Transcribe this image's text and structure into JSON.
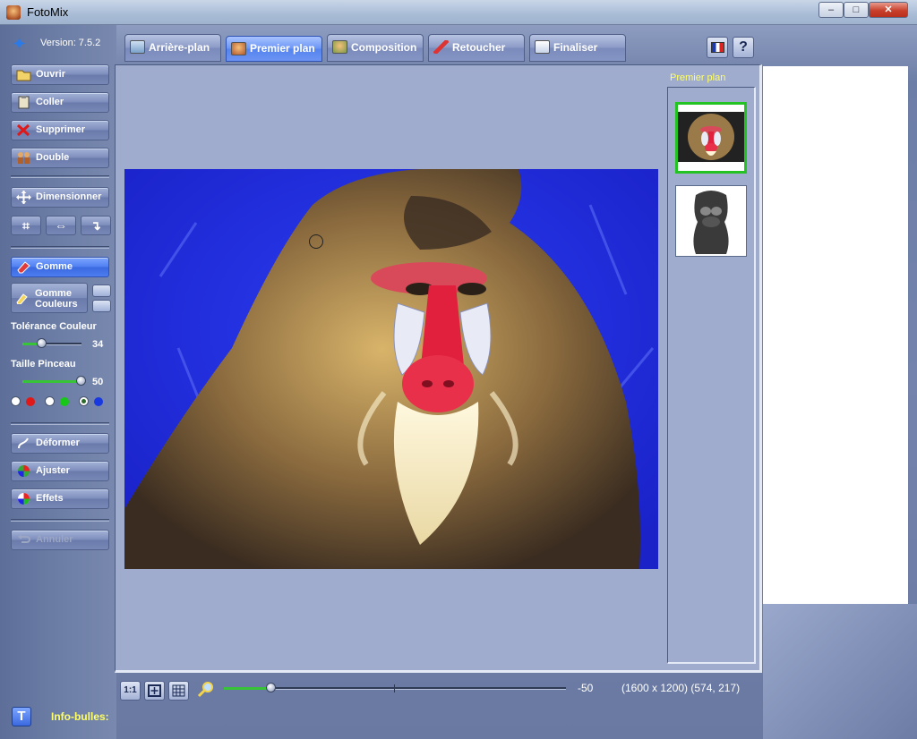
{
  "window": {
    "title": "FotoMix",
    "minimize": "–",
    "maximize": "□",
    "close": "✕"
  },
  "app": {
    "version": "Version: 7.5.2"
  },
  "tabs": [
    {
      "label": "Arrière-plan",
      "icon": "landscape-icon"
    },
    {
      "label": "Premier plan",
      "icon": "person-icon"
    },
    {
      "label": "Composition",
      "icon": "composition-icon"
    },
    {
      "label": "Retoucher",
      "icon": "brush-icon"
    },
    {
      "label": "Finaliser",
      "icon": "finish-icon"
    }
  ],
  "active_tab": "Premier plan",
  "help_label": "?",
  "sidebar": {
    "ouvrir": "Ouvrir",
    "coller": "Coller",
    "supprimer": "Supprimer",
    "double": "Double",
    "dimensionner": "Dimensionner",
    "crop_symbol": "⌗",
    "flip_symbol": "⇔",
    "rotate_symbol": "↴",
    "gomme": "Gomme",
    "gomme_couleurs_line1": "Gomme",
    "gomme_couleurs_line2": "Couleurs",
    "tolerance_label": "Tolérance Couleur",
    "tolerance_value": "34",
    "tolerance_fraction": 0.34,
    "taille_label": "Taille Pinceau",
    "taille_value": "50",
    "taille_fraction": 1.0,
    "deformer": "Déformer",
    "ajuster": "Ajuster",
    "effets": "Effets",
    "annuler": "Annuler"
  },
  "colors": {
    "red": "#e01818",
    "green": "#18c818",
    "blue": "#1838e0",
    "active_accent": "#4f7ef1"
  },
  "thumbnails": {
    "label": "Premier plan"
  },
  "bottom": {
    "btn_1to1": "1:1",
    "zoom_value": "-50",
    "zoom_fraction": 0.14,
    "coords": "(1600 x 1200) (574, 217)"
  },
  "footer": {
    "t_label": "T",
    "infobulles": "Info-bulles:"
  }
}
